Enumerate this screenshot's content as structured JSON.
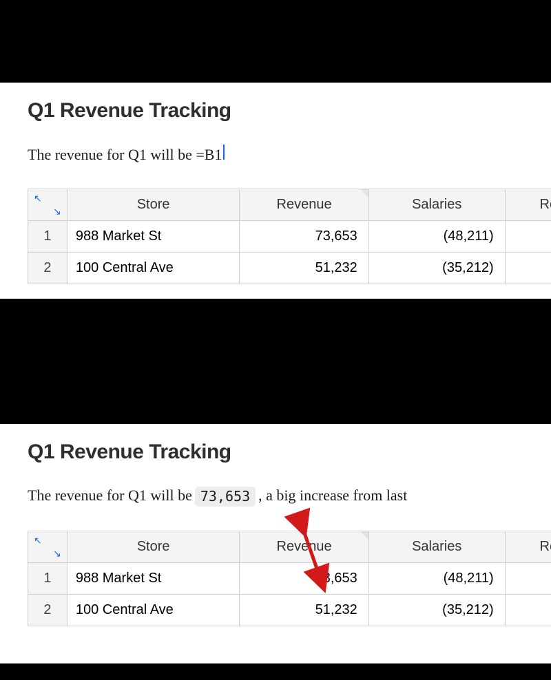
{
  "panel1": {
    "title": "Q1 Revenue Tracking",
    "sentence_pre": "The revenue for Q1 will be =B1"
  },
  "panel2": {
    "title": "Q1 Revenue Tracking",
    "sentence_pre": "The revenue for Q1 will be",
    "pill": "73,653",
    "sentence_post": ", a big increase from last "
  },
  "table": {
    "headers": {
      "store": "Store",
      "revenue": "Revenue",
      "salaries": "Salaries",
      "re": "Re"
    },
    "rows": [
      {
        "n": "1",
        "store": "988 Market St",
        "revenue": "73,653",
        "salaries": "(48,211)"
      },
      {
        "n": "2",
        "store": "100 Central Ave",
        "revenue": "51,232",
        "salaries": "(35,212)"
      }
    ]
  },
  "chart_data": {
    "type": "table",
    "columns": [
      "Store",
      "Revenue",
      "Salaries"
    ],
    "rows": [
      [
        "988 Market St",
        73653,
        -48211
      ],
      [
        "100 Central Ave",
        51232,
        -35212
      ]
    ]
  }
}
